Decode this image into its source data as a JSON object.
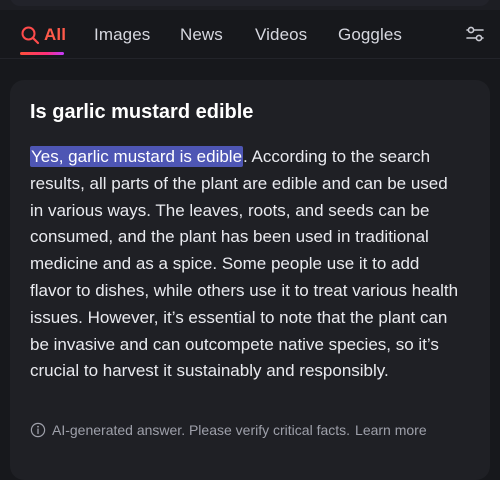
{
  "tabs": [
    {
      "label": "All",
      "active": true,
      "icon": "search-icon"
    },
    {
      "label": "Images"
    },
    {
      "label": "News"
    },
    {
      "label": "Videos"
    },
    {
      "label": "Goggles"
    }
  ],
  "settings_icon": "settings-sliders-icon",
  "answer": {
    "question": "Is garlic mustard edible",
    "highlight": "Yes, garlic mustard is edible",
    "body": ". According to the search results, all parts of the plant are edible and can be used in various ways. The leaves, roots, and seeds can be consumed, and the plant has been used in traditional medicine and as a spice. Some people use it to add flavor to dishes, while others use it to treat various health issues. However, it’s essential to note that the plant can be invasive and can outcompete native species, so it’s crucial to harvest it sustainably and responsibly.",
    "disclaimer": "AI-generated answer. Please verify critical facts.",
    "learn_more": "Learn more",
    "info_icon": "info-icon"
  },
  "colors": {
    "background": "#17181c",
    "card": "#1f2025",
    "accent_gradient_start": "#ff4f3a",
    "accent_gradient_end": "#c43bff",
    "highlight": "#4e56b4"
  }
}
